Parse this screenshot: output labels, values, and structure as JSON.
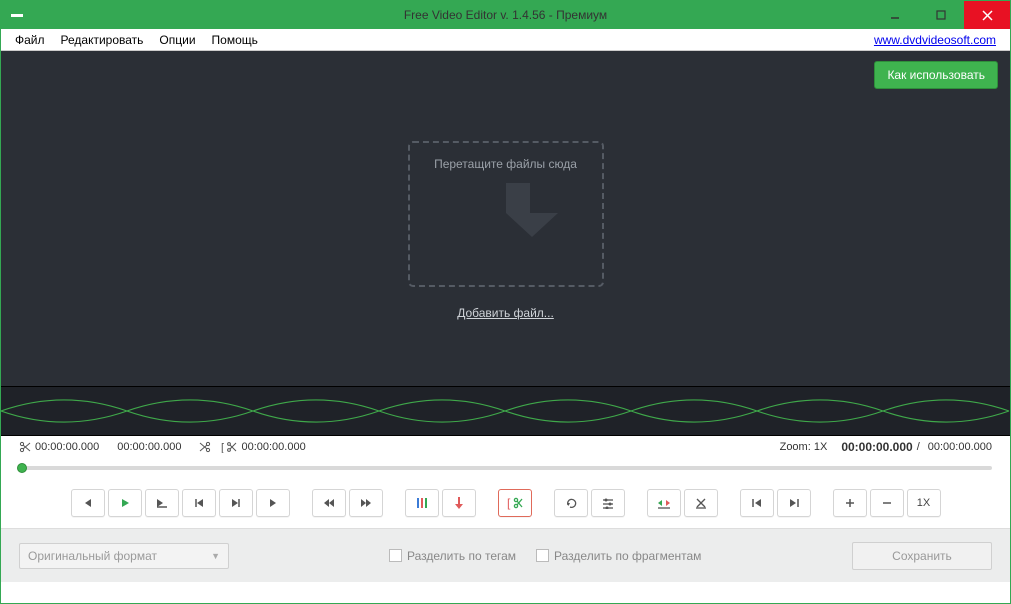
{
  "window": {
    "title": "Free Video Editor v. 1.4.56 - Премиум"
  },
  "menu": {
    "file": "Файл",
    "edit": "Редактировать",
    "options": "Опции",
    "help": "Помощь",
    "website": "www.dvdvideosoft.com"
  },
  "preview": {
    "how_to": "Как использовать",
    "drop_label": "Перетащите файлы сюда",
    "add_file": "Добавить файл..."
  },
  "time": {
    "cut_start": "00:00:00.000",
    "cut_mid": "00:00:00.000",
    "bracket": "00:00:00.000",
    "zoom_label": "Zoom:",
    "zoom_value": "1X",
    "position": "00:00:00.000",
    "duration": "00:00:00.000"
  },
  "toolbar": {
    "zoom_reset": "1X"
  },
  "bottom": {
    "format": "Оригинальный формат",
    "split_tags": "Разделить по тегам",
    "split_fragments": "Разделить по фрагментам",
    "save": "Сохранить"
  },
  "colors": {
    "accent": "#34a853",
    "danger": "#e81123",
    "bg_dark": "#2b2f36"
  }
}
